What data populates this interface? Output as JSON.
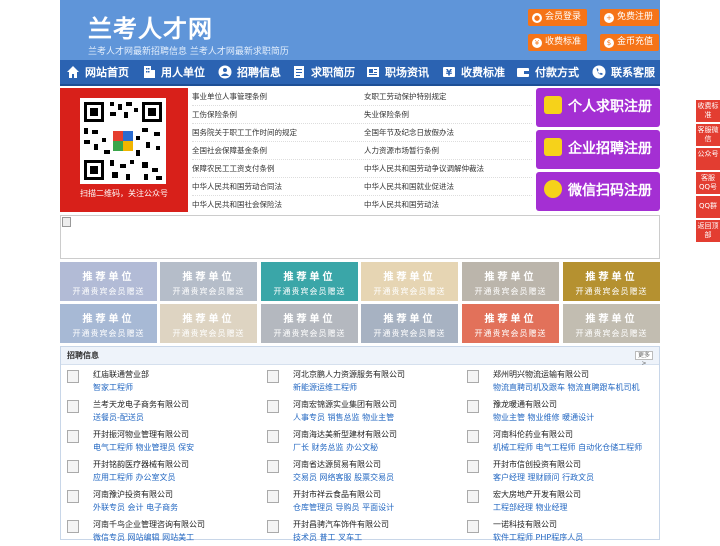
{
  "header": {
    "logo": "兰考人才网",
    "slogan": "兰考人才网最新招聘信息   兰考人才网最新求职简历",
    "buttons": [
      {
        "label": "会员登录",
        "icon": "user-icon"
      },
      {
        "label": "免费注册",
        "icon": "user-add-icon"
      },
      {
        "label": "收费标准",
        "icon": "yen-icon"
      },
      {
        "label": "金币充值",
        "icon": "coin-icon"
      }
    ]
  },
  "nav": [
    {
      "label": "网站首页",
      "icon": "home-icon"
    },
    {
      "label": "用人单位",
      "icon": "building-icon"
    },
    {
      "label": "招聘信息",
      "icon": "people-icon"
    },
    {
      "label": "求职简历",
      "icon": "resume-icon"
    },
    {
      "label": "职场资讯",
      "icon": "news-icon"
    },
    {
      "label": "收费标准",
      "icon": "yen-icon"
    },
    {
      "label": "付款方式",
      "icon": "wallet-icon"
    },
    {
      "label": "联系客服",
      "icon": "phone-icon"
    }
  ],
  "qr": {
    "caption": "扫描二维码，关注公众号"
  },
  "links": [
    [
      "事业单位人事管理条例",
      "女职工劳动保护特别规定"
    ],
    [
      "工伤保险条例",
      "失业保险条例"
    ],
    [
      "国务院关于职工工作时间的规定",
      "全国年节及纪念日放假办法"
    ],
    [
      "全国社会保障基金条例",
      "人力资源市场暂行条例"
    ],
    [
      "保障农民工工资支付条例",
      "中华人民共和国劳动争议调解仲裁法"
    ],
    [
      "中华人民共和国劳动合同法",
      "中华人民共和国就业促进法"
    ],
    [
      "中华人民共和国社会保险法",
      "中华人民共和国劳动法"
    ]
  ],
  "register": [
    {
      "label": "个人求职注册",
      "color": "#a42fd3"
    },
    {
      "label": "企业招聘注册",
      "color": "#a42fd3"
    },
    {
      "label": "微信扫码注册",
      "color": "#a42fd3"
    }
  ],
  "tiles": {
    "title": "推荐单位",
    "subtitle": "开通贵宾会员赠送",
    "colors": [
      "#b2bbd6",
      "#b5bdc9",
      "#3aa6a8",
      "#e6d5b3",
      "#bbb5ab",
      "#b59130",
      "#a7b9d5",
      "#ded4c2",
      "#b4b8bf",
      "#a7b2c2",
      "#e2715a",
      "#c2bdb1"
    ]
  },
  "jobs": {
    "heading": "招聘信息",
    "more": "更多>",
    "items": [
      {
        "company": "红庙联通营业部",
        "positions": "智家工程师"
      },
      {
        "company": "河北京鹏人力资源服务有限公司",
        "positions": "新能源运维工程师"
      },
      {
        "company": "郑州明兴物流运输有限公司",
        "positions": "物流直聘司机及跟车 物流直聘跟车机司机"
      },
      {
        "company": "兰考天龙电子商务有限公司",
        "positions": "送餐员-配送员"
      },
      {
        "company": "河南宏锦源实业集团有限公司",
        "positions": "人事专员 销售总监 物业主管"
      },
      {
        "company": "豫龙暖通有限公司",
        "positions": "物业主管 物业维修 暖通设计"
      },
      {
        "company": "开封振河物业管理有限公司",
        "positions": "电气工程师 物业管理员 保安"
      },
      {
        "company": "河南海达美新型建材有限公司",
        "positions": "厂长 财务总监 办公文秘"
      },
      {
        "company": "河南科伦药业有限公司",
        "positions": "机械工程师 电气工程师 自动化仓储工程师"
      },
      {
        "company": "开封铭韵医疗器械有限公司",
        "positions": "应用工程师 办公室文员"
      },
      {
        "company": "河南省达源贸易有限公司",
        "positions": "交易员 网络客服 股票交易员"
      },
      {
        "company": "开封市信创投资有限公司",
        "positions": "客户经理 理财顾问 行政文员"
      },
      {
        "company": "河南豫沪投资有限公司",
        "positions": "外联专员 会计 电子商务"
      },
      {
        "company": "开封市祥云食品有限公司",
        "positions": "仓库管理员 导购员 平面设计"
      },
      {
        "company": "宏大房地产开发有限公司",
        "positions": "工程部经理 物业经理"
      },
      {
        "company": "河南千鸟企业管理咨询有限公司",
        "positions": "微信专员 网站编辑 网站美工"
      },
      {
        "company": "开封昌骋汽车饰件有限公司",
        "positions": "技术员 普工 叉车工"
      },
      {
        "company": "一诺科技有限公司",
        "positions": "软件工程师 PHP程序人员"
      }
    ]
  },
  "side": [
    {
      "label": "收费标准"
    },
    {
      "label": "客服微信"
    },
    {
      "label": "公众号"
    },
    {
      "label": "客服QQ号"
    },
    {
      "label": "QQ群"
    },
    {
      "label": "返回顶部"
    }
  ]
}
